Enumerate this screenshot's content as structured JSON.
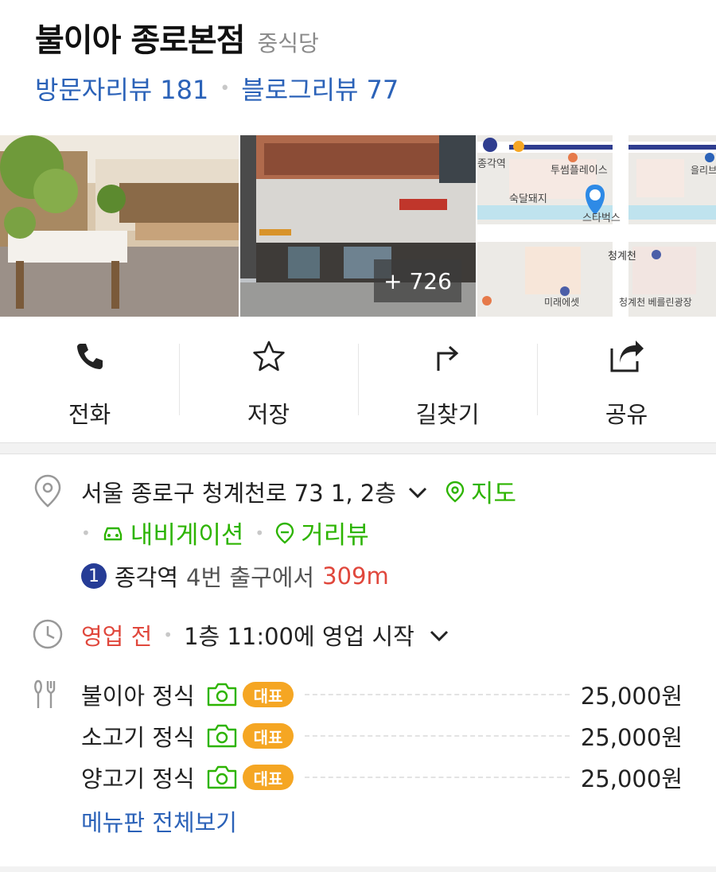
{
  "place": {
    "name": "불이아 종로본점",
    "category": "중식당",
    "visitor_reviews_label": "방문자리뷰",
    "visitor_reviews_count": "181",
    "blog_reviews_label": "블로그리뷰",
    "blog_reviews_count": "77"
  },
  "photos": {
    "more_count": "+ 726",
    "map_labels": {
      "station": "종각역",
      "building1": "투썸플레이스",
      "building2": "숙달돼지",
      "building3": "스타벅스",
      "stream": "청계천",
      "plaza": "청계천 베를린광장",
      "other": "미래에셋",
      "other2": "을리브"
    }
  },
  "actions": [
    {
      "label": "전화",
      "icon": "phone-icon"
    },
    {
      "label": "저장",
      "icon": "star-icon"
    },
    {
      "label": "길찾기",
      "icon": "directions-icon"
    },
    {
      "label": "공유",
      "icon": "share-icon"
    }
  ],
  "address": {
    "text": "서울 종로구 청계천로 73 1, 2층",
    "map_label": "지도",
    "navigation_label": "내비게이션",
    "streetview_label": "거리뷰",
    "subway_line": "1",
    "station": "종각역",
    "exit": "4번 출구에서",
    "distance": "309m"
  },
  "hours": {
    "status": "영업 전",
    "detail": "1층 11:00에 영업 시작"
  },
  "menu": {
    "items": [
      {
        "name": "불이아 정식",
        "badge": "대표",
        "price": "25,000원"
      },
      {
        "name": "소고기 정식",
        "badge": "대표",
        "price": "25,000원"
      },
      {
        "name": "양고기 정식",
        "badge": "대표",
        "price": "25,000원"
      }
    ],
    "view_all_label": "메뉴판 전체보기"
  },
  "colors": {
    "link_blue": "#2b62b8",
    "green": "#2db400",
    "red": "#e0473c",
    "badge_orange": "#f5a623",
    "subway_line1": "#263c96"
  }
}
